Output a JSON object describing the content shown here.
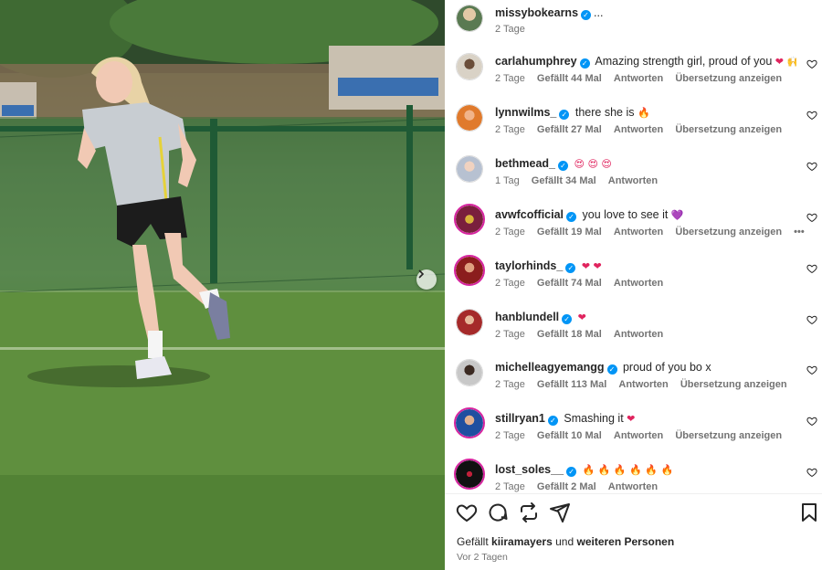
{
  "post": {
    "author": "missybokearns",
    "author_suffix": "...",
    "age": "2 Tage"
  },
  "comments": [
    {
      "username": "carlahumphrey",
      "text": "Amazing strength girl, proud of you",
      "emoji": "❤ 🙌",
      "age": "2 Tage",
      "likes": "Gefällt 44 Mal",
      "reply": "Antworten",
      "translate": "Übersetzung anzeigen",
      "avatar_color": "#c9c3ba"
    },
    {
      "username": "lynnwilms_",
      "text": "there she is",
      "emoji": "🔥",
      "age": "2 Tage",
      "likes": "Gefällt 27 Mal",
      "reply": "Antworten",
      "translate": "Übersetzung anzeigen",
      "avatar_color": "#e07a2c"
    },
    {
      "username": "bethmead_",
      "text": "",
      "emoji": "😍 😍 😍",
      "age": "1 Tag",
      "likes": "Gefällt 34 Mal",
      "reply": "Antworten",
      "translate": "",
      "avatar_color": "#b7c1d1"
    },
    {
      "username": "avwfcofficial",
      "text": "you love to see it",
      "emoji": "💜",
      "age": "2 Tage",
      "likes": "Gefällt 19 Mal",
      "reply": "Antworten",
      "translate": "Übersetzung anzeigen",
      "more": "•••",
      "avatar_color": "#7a1f3d"
    },
    {
      "username": "taylorhinds_",
      "text": "",
      "emoji": "❤ ❤",
      "age": "2 Tage",
      "likes": "Gefällt 74 Mal",
      "reply": "Antworten",
      "translate": "",
      "avatar_color": "#8b1d1d"
    },
    {
      "username": "hanblundell",
      "text": "",
      "emoji": "❤",
      "age": "2 Tage",
      "likes": "Gefällt 18 Mal",
      "reply": "Antworten",
      "translate": "",
      "avatar_color": "#a52a2a"
    },
    {
      "username": "michelleagyemangg",
      "text": "proud of you bo x",
      "emoji": "",
      "age": "2 Tage",
      "likes": "Gefällt 113 Mal",
      "reply": "Antworten",
      "translate": "Übersetzung anzeigen",
      "avatar_color": "#c8c8c8"
    },
    {
      "username": "stillryan1",
      "text": "Smashing it",
      "emoji": "❤",
      "age": "2 Tage",
      "likes": "Gefällt 10 Mal",
      "reply": "Antworten",
      "translate": "Übersetzung anzeigen",
      "avatar_color": "#1f4fa0"
    },
    {
      "username": "lost_soles__",
      "text": "",
      "emoji": "🔥 🔥 🔥 🔥 🔥 🔥",
      "age": "2 Tage",
      "likes": "Gefällt 2 Mal",
      "reply": "Antworten",
      "translate": "",
      "avatar_color": "#111111"
    }
  ],
  "footer": {
    "liked_prefix": "Gefällt",
    "liked_user": "kiiramayers",
    "liked_middle": "und",
    "liked_others": "weiteren Personen",
    "date": "Vor 2 Tagen"
  },
  "icons": {
    "like": "heart-icon",
    "comment": "comment-bubble-icon",
    "share": "repost-icon",
    "send": "paper-plane-icon",
    "save": "bookmark-icon",
    "verified": "verified-badge-icon",
    "next": "chevron-right-icon"
  },
  "colors": {
    "verified": "#0095f6",
    "meta_text": "#737373",
    "story_ring": "#d6249f"
  }
}
